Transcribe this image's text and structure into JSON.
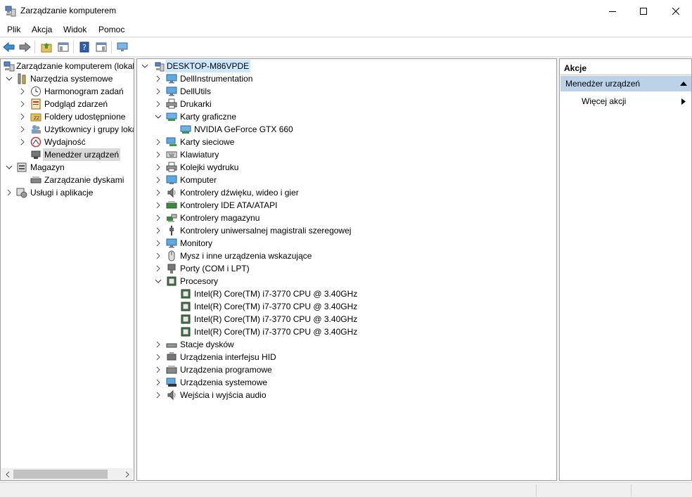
{
  "window": {
    "title": "Zarządzanie komputerem",
    "app_icon": "computer-management-icon",
    "controls": [
      "minimize-icon",
      "maximize-icon",
      "close-icon"
    ]
  },
  "menu": [
    "Plik",
    "Akcja",
    "Widok",
    "Pomoc"
  ],
  "toolbar": [
    "back-arrow-icon",
    "forward-arrow-icon",
    "up-folder-icon",
    "show-hide-console-tree-icon",
    "help-icon",
    "show-hide-action-pane-icon",
    "monitor-icon"
  ],
  "left_tree": {
    "root": "Zarządzanie komputerem (lokalny)",
    "items": [
      {
        "label": "Narzędzia systemowe",
        "icon": "tools-icon"
      },
      {
        "label": "Harmonogram zadań",
        "icon": "clock-icon"
      },
      {
        "label": "Podgląd zdarzeń",
        "icon": "event-viewer-icon"
      },
      {
        "label": "Foldery udostępnione",
        "icon": "shared-folder-icon"
      },
      {
        "label": "Użytkownicy i grupy lokalne",
        "icon": "users-icon"
      },
      {
        "label": "Wydajność",
        "icon": "performance-icon"
      },
      {
        "label": "Menedżer urządzeń",
        "icon": "device-manager-icon"
      },
      {
        "label": "Magazyn",
        "icon": "storage-icon"
      },
      {
        "label": "Zarządzanie dyskami",
        "icon": "disk-management-icon"
      },
      {
        "label": "Usługi i aplikacje",
        "icon": "services-icon"
      }
    ]
  },
  "device_tree": {
    "root": "DESKTOP-M86VPDE",
    "items": [
      {
        "label": "DellInstrumentation",
        "icon": "monitor-icon"
      },
      {
        "label": "DellUtils",
        "icon": "monitor-icon"
      },
      {
        "label": "Drukarki",
        "icon": "printer-icon"
      },
      {
        "label": "Karty graficzne",
        "icon": "display-adapter-icon"
      },
      {
        "label": "NVIDIA GeForce GTX 660",
        "icon": "display-adapter-icon"
      },
      {
        "label": "Karty sieciowe",
        "icon": "network-adapter-icon"
      },
      {
        "label": "Klawiatury",
        "icon": "keyboard-icon"
      },
      {
        "label": "Kolejki wydruku",
        "icon": "printer-icon"
      },
      {
        "label": "Komputer",
        "icon": "computer-icon"
      },
      {
        "label": "Kontrolery dźwięku, wideo i gier",
        "icon": "speaker-icon"
      },
      {
        "label": "Kontrolery IDE ATA/ATAPI",
        "icon": "ide-controller-icon"
      },
      {
        "label": "Kontrolery magazynu",
        "icon": "storage-controller-icon"
      },
      {
        "label": "Kontrolery uniwersalnej magistrali szeregowej",
        "icon": "usb-icon"
      },
      {
        "label": "Monitory",
        "icon": "monitor-icon"
      },
      {
        "label": "Mysz i inne urządzenia wskazujące",
        "icon": "mouse-icon"
      },
      {
        "label": "Porty (COM i LPT)",
        "icon": "port-icon"
      },
      {
        "label": "Procesory",
        "icon": "processor-icon"
      },
      {
        "label": "Intel(R) Core(TM) i7-3770 CPU @ 3.40GHz",
        "icon": "processor-icon"
      },
      {
        "label": "Intel(R) Core(TM) i7-3770 CPU @ 3.40GHz",
        "icon": "processor-icon"
      },
      {
        "label": "Intel(R) Core(TM) i7-3770 CPU @ 3.40GHz",
        "icon": "processor-icon"
      },
      {
        "label": "Intel(R) Core(TM) i7-3770 CPU @ 3.40GHz",
        "icon": "processor-icon"
      },
      {
        "label": "Stacje dysków",
        "icon": "disk-drive-icon"
      },
      {
        "label": "Urządzenia interfejsu HID",
        "icon": "hid-icon"
      },
      {
        "label": "Urządzenia programowe",
        "icon": "software-device-icon"
      },
      {
        "label": "Urządzenia systemowe",
        "icon": "system-device-icon"
      },
      {
        "label": "Wejścia i wyjścia audio",
        "icon": "speaker-icon"
      }
    ]
  },
  "actions": {
    "header": "Akcje",
    "section": "Menedżer urządzeń",
    "more": "Więcej akcji"
  }
}
